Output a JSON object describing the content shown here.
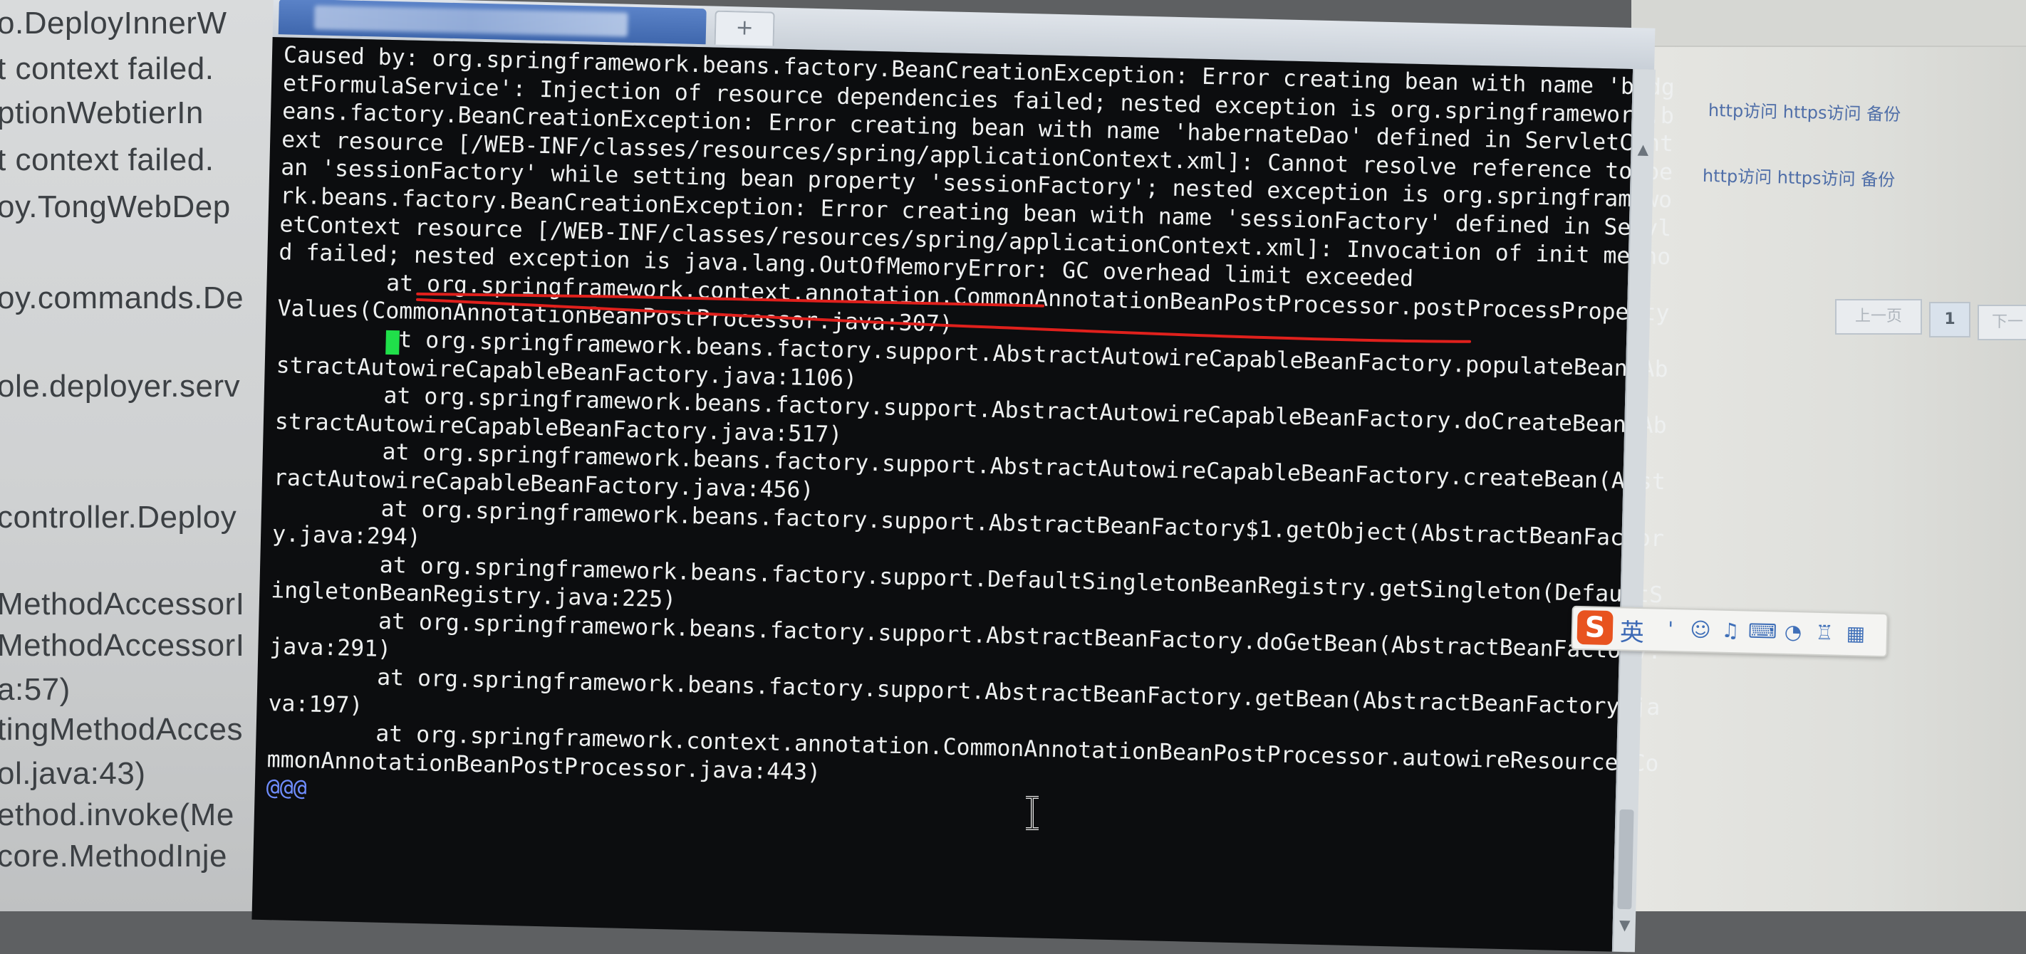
{
  "background_left": {
    "lines": [
      {
        "text": "o.DeployInnerW"
      },
      {
        "text": "t context failed."
      },
      {
        "text": "ptionWebtierIn"
      },
      {
        "text": "t context failed."
      },
      {
        "text": "oy.TongWebDep"
      },
      {
        "text": "oy.commands.De"
      },
      {
        "text": "ole.deployer.serv"
      },
      {
        "text": "controller.Deploy"
      },
      {
        "text": "MethodAccessorI"
      },
      {
        "text": "MethodAccessorI"
      },
      {
        "text": "a:57)"
      },
      {
        "text": "tingMethodAcces"
      },
      {
        "text": "ol.java:43)"
      },
      {
        "text": "ethod.invoke(Me"
      },
      {
        "text": "core.MethodInje"
      }
    ]
  },
  "background_right": {
    "link_row_1": "http访问  https访问  备份",
    "link_row_2": "http访问  https访问  备份",
    "pager": {
      "prev": "上一页",
      "current": "1",
      "next": "下一"
    }
  },
  "terminal": {
    "tab_new_label": "+",
    "lines": [
      "Caused by: org.springframework.beans.factory.BeanCreationException: Error creating bean with name 'budg",
      "etFormulaService': Injection of resource dependencies failed; nested exception is org.springframework.b",
      "eans.factory.BeanCreationException: Error creating bean with name 'habernateDao' defined in ServletCont",
      "ext resource [/WEB-INF/classes/resources/spring/applicationContext.xml]: Cannot resolve reference to be",
      "an 'sessionFactory' while setting bean property 'sessionFactory'; nested exception is org.springframewo",
      "rk.beans.factory.BeanCreationException: Error creating bean with name 'sessionFactory' defined in Servl",
      "etContext resource [/WEB-INF/classes/resources/spring/applicationContext.xml]: Invocation of init metho",
      "d failed; nested exception is java.lang.OutOfMemoryError: GC overhead limit exceeded",
      "        at org.springframework.context.annotation.CommonAnnotationBeanPostProcessor.postProcessProperty",
      "Values(CommonAnnotationBeanPostProcessor.java:307)",
      "        at org.springframework.beans.factory.support.AbstractAutowireCapableBeanFactory.populateBean(Ab",
      "stractAutowireCapableBeanFactory.java:1106)",
      "        at org.springframework.beans.factory.support.AbstractAutowireCapableBeanFactory.doCreateBean(Ab",
      "stractAutowireCapableBeanFactory.java:517)",
      "        at org.springframework.beans.factory.support.AbstractAutowireCapableBeanFactory.createBean(Abst",
      "ractAutowireCapableBeanFactory.java:456)",
      "        at org.springframework.beans.factory.support.AbstractBeanFactory$1.getObject(AbstractBeanFactor",
      "y.java:294)",
      "        at org.springframework.beans.factory.support.DefaultSingletonBeanRegistry.getSingleton(DefaultS",
      "ingletonBeanRegistry.java:225)",
      "        at org.springframework.beans.factory.support.AbstractBeanFactory.doGetBean(AbstractBeanFactory.",
      "java:291)",
      "        at org.springframework.beans.factory.support.AbstractBeanFactory.getBean(AbstractBeanFactory.ja",
      "va:197)",
      "        at org.springframework.context.annotation.CommonAnnotationBeanPostProcessor.autowireResource(Co",
      "mmonAnnotationBeanPostProcessor.java:443)"
    ],
    "prompt": "@@@",
    "colors": {
      "background": "#0c0d0f",
      "text": "#eef0f0",
      "cursor": "#20e04a",
      "prompt": "#6f8dff",
      "annotation": "#e0201c"
    }
  },
  "ime_toolbar": {
    "logo": "S",
    "language": "英",
    "icons": [
      "punctuation-icon",
      "emoji-icon",
      "microphone-icon",
      "keyboard-icon",
      "skin-icon",
      "shirt-icon",
      "grid-icon"
    ]
  }
}
